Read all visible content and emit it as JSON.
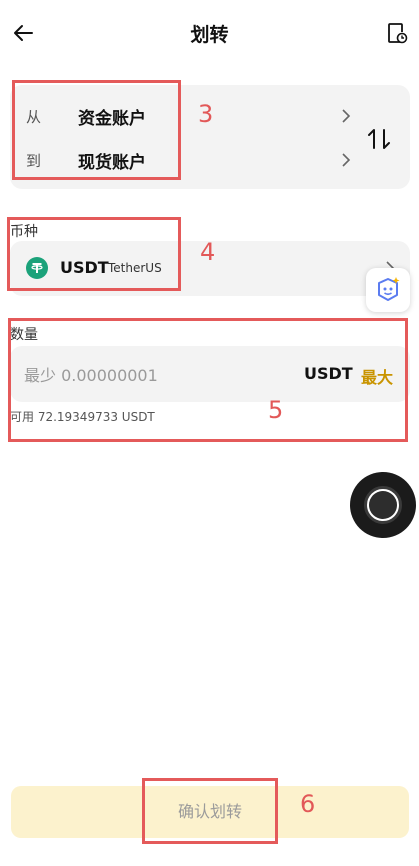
{
  "header": {
    "title": "划转",
    "back_icon": "arrow-left-icon",
    "history_icon": "record-clock-icon"
  },
  "transfer": {
    "from_label": "从",
    "from_account": "资金账户",
    "to_label": "到",
    "to_account": "现货账户",
    "swap_icon": "swap-vertical-icon"
  },
  "currency": {
    "section_label": "币种",
    "code": "USDT",
    "name": "TetherUS",
    "logo_color": "#1ba27a"
  },
  "amount": {
    "section_label": "数量",
    "placeholder": "最少 0.00000001",
    "unit": "USDT",
    "max_label": "最大",
    "available": "可用 72.19349733 USDT"
  },
  "confirm": {
    "label": "确认划转"
  },
  "annotations": [
    "3",
    "4",
    "5",
    "6"
  ],
  "colors": {
    "accent": "#c99400",
    "confirm_bg": "#fcf2cd",
    "annotation": "#e45a5a"
  }
}
